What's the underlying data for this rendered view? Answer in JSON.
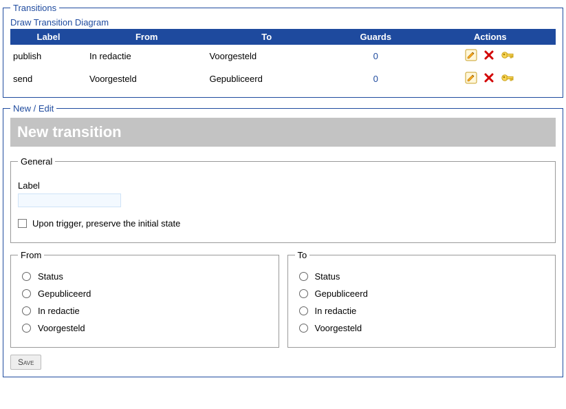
{
  "transitions_panel": {
    "legend": "Transitions",
    "draw_link": "Draw Transition Diagram",
    "columns": [
      "Label",
      "From",
      "To",
      "Guards",
      "Actions"
    ],
    "rows": [
      {
        "label": "publish",
        "from": "In redactie",
        "to": "Voorgesteld",
        "guards": "0"
      },
      {
        "label": "send",
        "from": "Voorgesteld",
        "to": "Gepubliceerd",
        "guards": "0"
      }
    ]
  },
  "edit_panel": {
    "legend": "New / Edit",
    "heading": "New transition",
    "general": {
      "legend": "General",
      "label_field_label": "Label",
      "label_value": "",
      "checkbox_label": "Upon trigger, preserve the initial state"
    },
    "from": {
      "legend": "From",
      "options": [
        "Status",
        "Gepubliceerd",
        "In redactie",
        "Voorgesteld"
      ]
    },
    "to": {
      "legend": "To",
      "options": [
        "Status",
        "Gepubliceerd",
        "In redactie",
        "Voorgesteld"
      ]
    },
    "save_label": "Save"
  },
  "icons": {
    "edit": "edit-icon",
    "delete": "delete-icon",
    "key": "key-icon"
  }
}
